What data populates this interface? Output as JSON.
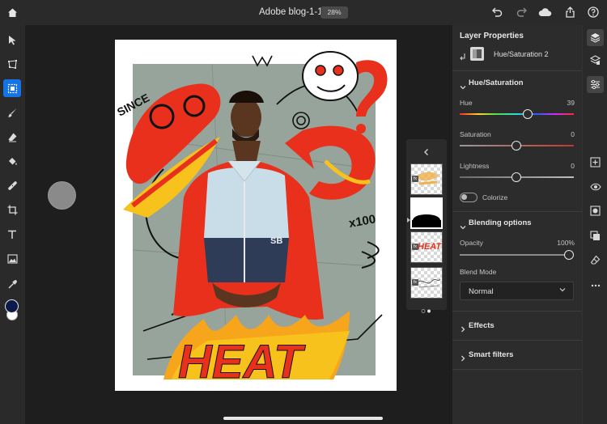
{
  "top_bar": {
    "home_icon": "home-icon",
    "document_title": "Adobe blog-1-1-1",
    "zoom": "28%",
    "actions": [
      "undo-icon",
      "redo-icon",
      "cloud-icon",
      "share-icon",
      "help-icon"
    ]
  },
  "toolbar": {
    "tools": [
      "move-icon",
      "transform-icon",
      "selection-icon",
      "brush-icon",
      "eraser-icon",
      "fill-icon",
      "healing-icon",
      "crop-icon",
      "type-icon",
      "image-icon",
      "eyedropper-icon"
    ],
    "active_tool": "selection-icon",
    "foreground_color": "#0a1a4a",
    "background_color": "#ffffff"
  },
  "selection_flyout": {
    "tools": [
      "marquee-icon",
      "lasso-icon",
      "object-select-icon",
      "more-icon"
    ]
  },
  "canvas": {
    "artwork_text": [
      "SINCE 1992",
      "HEAT",
      "x100",
      "SB"
    ],
    "accent_colors": [
      "#e8301c",
      "#f7c21b",
      "#111111"
    ]
  },
  "layers_strip": {
    "collapse_icon": "chevron-left-icon",
    "layer_count": 4,
    "selected_index": 1,
    "thumb_heat_text": "HEAT"
  },
  "properties": {
    "panel_title": "Layer Properties",
    "layer_name": "Hue/Saturation 2",
    "hue_saturation": {
      "title": "Hue/Saturation",
      "hue": {
        "label": "Hue",
        "value": "39"
      },
      "saturation": {
        "label": "Saturation",
        "value": "0"
      },
      "lightness": {
        "label": "Lightness",
        "value": "0"
      },
      "colorize": {
        "label": "Colorize",
        "on": false
      }
    },
    "blending": {
      "title": "Blending options",
      "opacity": {
        "label": "Opacity",
        "value": "100%"
      },
      "blend_mode": {
        "label": "Blend Mode",
        "value": "Normal"
      }
    },
    "effects": {
      "title": "Effects"
    },
    "smart_filters": {
      "title": "Smart filters"
    }
  },
  "right_rail": {
    "buttons": [
      "layers-icon",
      "layer-properties-icon",
      "adjustments-icon",
      "add-layer-icon",
      "visibility-icon",
      "mask-icon",
      "clipping-icon",
      "erase-layer-icon",
      "more-icon"
    ],
    "active": "layers-icon"
  }
}
